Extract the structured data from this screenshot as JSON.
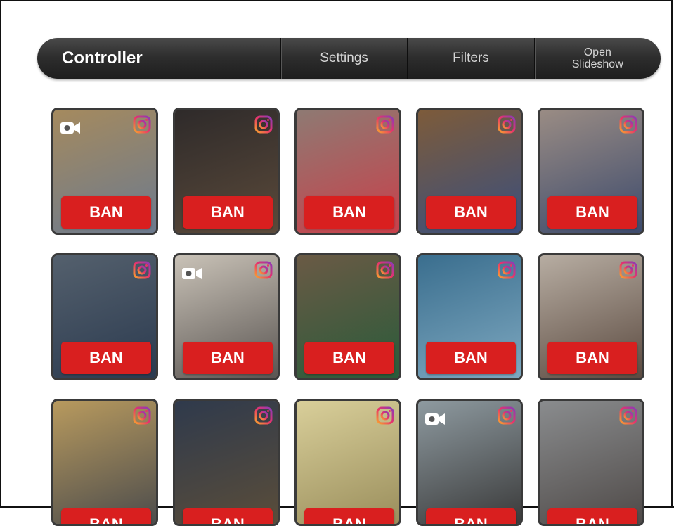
{
  "nav": {
    "brand": "Controller",
    "settings": "Settings",
    "filters": "Filters",
    "slideshow": "Open\nSlideshow"
  },
  "tiles": [
    {
      "ban": "BAN",
      "source_icon": "instagram-icon",
      "video": true,
      "c1": "#a58a5e",
      "c2": "#6c7a8e"
    },
    {
      "ban": "BAN",
      "source_icon": "instagram-icon",
      "video": false,
      "c1": "#2e2a2a",
      "c2": "#5b4a3a"
    },
    {
      "ban": "BAN",
      "source_icon": "instagram-icon",
      "video": false,
      "c1": "#8e7a73",
      "c2": "#c9404a"
    },
    {
      "ban": "BAN",
      "source_icon": "instagram-icon",
      "video": false,
      "c1": "#7d5b3a",
      "c2": "#3a4f7d"
    },
    {
      "ban": "BAN",
      "source_icon": "instagram-icon",
      "video": false,
      "c1": "#9a8c84",
      "c2": "#3c4a6c"
    },
    {
      "ban": "BAN",
      "source_icon": "instagram-icon",
      "video": false,
      "c1": "#54606d",
      "c2": "#2b3a4f"
    },
    {
      "ban": "BAN",
      "source_icon": "instagram-icon",
      "video": true,
      "c1": "#c9c2b7",
      "c2": "#5a5552"
    },
    {
      "ban": "BAN",
      "source_icon": "instagram-icon",
      "video": false,
      "c1": "#6a5a45",
      "c2": "#2a5b3a"
    },
    {
      "ban": "BAN",
      "source_icon": "instagram-icon",
      "video": false,
      "c1": "#3a6e8e",
      "c2": "#7ea8c0"
    },
    {
      "ban": "BAN",
      "source_icon": "instagram-icon",
      "video": false,
      "c1": "#b7ada2",
      "c2": "#5b4a40"
    },
    {
      "ban": "BAN",
      "source_icon": "instagram-icon",
      "video": false,
      "c1": "#b89a5e",
      "c2": "#4c4c4c"
    },
    {
      "ban": "BAN",
      "source_icon": "instagram-icon",
      "video": false,
      "c1": "#2f3a4c",
      "c2": "#5a4d3a"
    },
    {
      "ban": "BAN",
      "source_icon": "instagram-icon",
      "video": false,
      "c1": "#d9cf9a",
      "c2": "#9a8e5c"
    },
    {
      "ban": "BAN",
      "source_icon": "instagram-icon",
      "video": true,
      "c1": "#8e9aa0",
      "c2": "#3a3a3a"
    },
    {
      "ban": "BAN",
      "source_icon": "instagram-icon",
      "video": false,
      "c1": "#8a8c8e",
      "c2": "#4f4a48"
    }
  ],
  "colors": {
    "ban": "#d91f1f",
    "nav": "#2e2e2e"
  }
}
